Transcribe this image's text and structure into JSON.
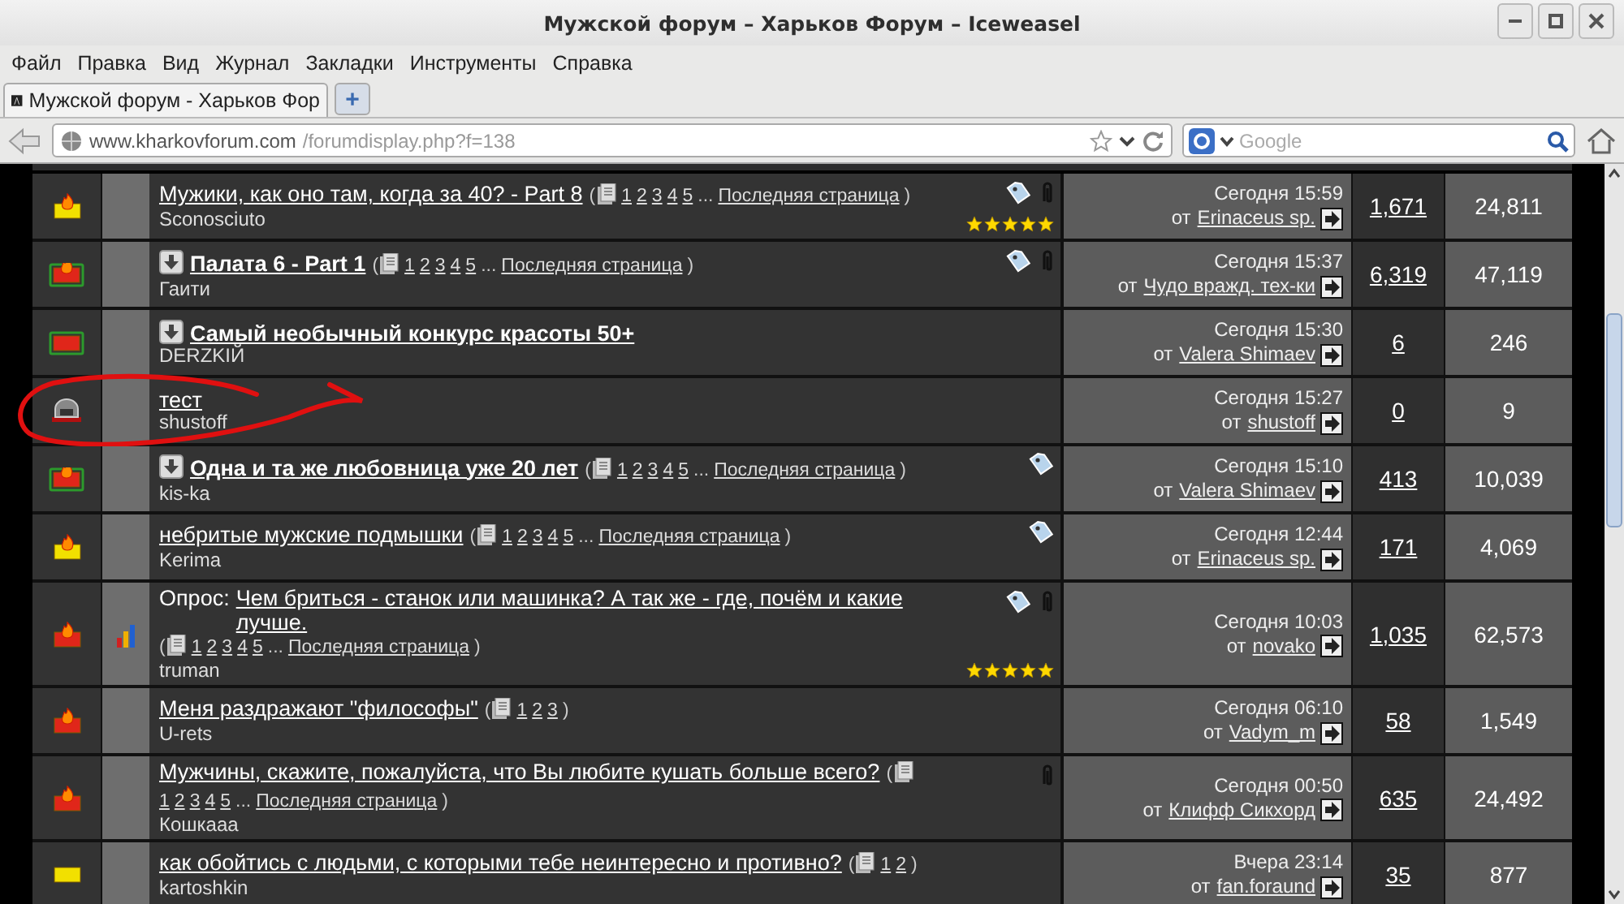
{
  "window": {
    "title": "Мужской форум – Харьков Форум – Iceweasel"
  },
  "menu": [
    "Файл",
    "Правка",
    "Вид",
    "Журнал",
    "Закладки",
    "Инструменты",
    "Справка"
  ],
  "tabs": [
    {
      "label": "Мужской форум - Харьков Фор",
      "selected": true
    }
  ],
  "new_tab": "+",
  "address": {
    "domain": "www.kharkovforum.com",
    "path": "/forumdisplay.php?f=138"
  },
  "search": {
    "placeholder": "Google"
  },
  "threads": [
    {
      "kind": "hot",
      "poll": false,
      "arrow": false,
      "title": "Мужики, как оно там, когда за 40? - Part 8",
      "bold": false,
      "pager": {
        "open": "(",
        "pages": [
          "1",
          "2",
          "3",
          "4",
          "5"
        ],
        "ellipsis": "...",
        "last": "Последняя страница",
        "close": ")"
      },
      "author": "Sconosciuto",
      "tag": true,
      "clip": true,
      "stars": 5,
      "date": "Сегодня 15:59",
      "by": "от",
      "last_user": "Erinaceus sp.",
      "replies": "1,671",
      "views": "24,811",
      "circled": false
    },
    {
      "kind": "hot_new",
      "poll": false,
      "arrow": true,
      "title": "Палата 6 - Part 1",
      "bold": true,
      "pager": {
        "open": "(",
        "pages": [
          "1",
          "2",
          "3",
          "4",
          "5"
        ],
        "ellipsis": "...",
        "last": "Последняя страница",
        "close": ")"
      },
      "author": "Гаити",
      "tag": true,
      "clip": true,
      "date": "Сегодня 15:37",
      "by": "от",
      "last_user": "Чудо вражд. тех-ки",
      "replies": "6,319",
      "views": "47,119",
      "circled": false
    },
    {
      "kind": "new",
      "poll": false,
      "arrow": true,
      "title": "Самый необычный конкурс красоты 50+",
      "bold": true,
      "author": "DERZKIЙ",
      "tag": false,
      "clip": false,
      "date": "Сегодня 15:30",
      "by": "от",
      "last_user": "Valera Shimaev",
      "replies": "6",
      "views": "246",
      "circled": false
    },
    {
      "kind": "locked",
      "poll": false,
      "arrow": false,
      "title": "тест",
      "bold": false,
      "author": "shustoff",
      "tag": false,
      "clip": false,
      "date": "Сегодня 15:27",
      "by": "от",
      "last_user": "shustoff",
      "replies": "0",
      "views": "9",
      "circled": true
    },
    {
      "kind": "hot_new",
      "poll": false,
      "arrow": true,
      "title": "Одна и та же любовница уже 20 лет",
      "bold": true,
      "pager": {
        "open": "(",
        "pages": [
          "1",
          "2",
          "3",
          "4",
          "5"
        ],
        "ellipsis": "...",
        "last": "Последняя страница",
        "close": ")"
      },
      "author": "kis-ka",
      "tag": true,
      "clip": false,
      "date": "Сегодня 15:10",
      "by": "от",
      "last_user": "Valera Shimaev",
      "replies": "413",
      "views": "10,039",
      "circled": false
    },
    {
      "kind": "hot",
      "poll": false,
      "arrow": false,
      "title": "небритые мужские подмышки",
      "bold": false,
      "pager": {
        "open": "(",
        "pages": [
          "1",
          "2",
          "3",
          "4",
          "5"
        ],
        "ellipsis": "...",
        "last": "Последняя страница",
        "close": ")"
      },
      "author": "Kerima",
      "tag": true,
      "clip": false,
      "date": "Сегодня 12:44",
      "by": "от",
      "last_user": "Erinaceus sp.",
      "replies": "171",
      "views": "4,069",
      "circled": false
    },
    {
      "kind": "hot_red",
      "poll": true,
      "arrow": false,
      "prefix": "Опрос:",
      "title": "Чем бриться - станок или машинка? А так же - где, почём и какие лучше.",
      "bold": false,
      "pager": {
        "open": "(",
        "pages": [
          "1",
          "2",
          "3",
          "4",
          "5"
        ],
        "ellipsis": "...",
        "last": "Последняя страница",
        "close": ")"
      },
      "author": "truman",
      "tag": true,
      "clip": true,
      "stars": 5,
      "date": "Сегодня 10:03",
      "by": "от",
      "last_user": "novako",
      "replies": "1,035",
      "views": "62,573",
      "circled": false
    },
    {
      "kind": "hot_red",
      "poll": false,
      "arrow": false,
      "title": "Меня раздражают \"философы\"",
      "bold": false,
      "pager": {
        "open": "(",
        "pages": [
          "1",
          "2",
          "3"
        ],
        "close": ")"
      },
      "author": "U-rets",
      "tag": false,
      "clip": false,
      "date": "Сегодня 06:10",
      "by": "от",
      "last_user": "Vadym_m",
      "replies": "58",
      "views": "1,549",
      "circled": false
    },
    {
      "kind": "hot_red",
      "poll": false,
      "arrow": false,
      "title": "Мужчины, скажите, пожалуйста, что Вы любите кушать больше всего?",
      "bold": false,
      "pager": {
        "open": "(",
        "pages": [
          "1",
          "2",
          "3",
          "4",
          "5"
        ],
        "ellipsis": "...",
        "last": "Последняя страница",
        "close": ")"
      },
      "author": "Кошкааа",
      "tag": false,
      "clip": true,
      "date": "Сегодня 00:50",
      "by": "от",
      "last_user": "Клифф Сикхорд",
      "replies": "635",
      "views": "24,492",
      "circled": false
    },
    {
      "kind": "plain",
      "poll": false,
      "arrow": false,
      "title": "как обойтись с людьми, с которыми тебе неинтересно и противно?",
      "bold": false,
      "pager": {
        "open": "(",
        "pages": [
          "1",
          "2"
        ],
        "close": ")"
      },
      "author": "kartoshkin",
      "tag": false,
      "clip": false,
      "date": "Вчера 23:14",
      "by": "от",
      "last_user": "fan.foraund",
      "replies": "35",
      "views": "877",
      "circled": false
    }
  ]
}
